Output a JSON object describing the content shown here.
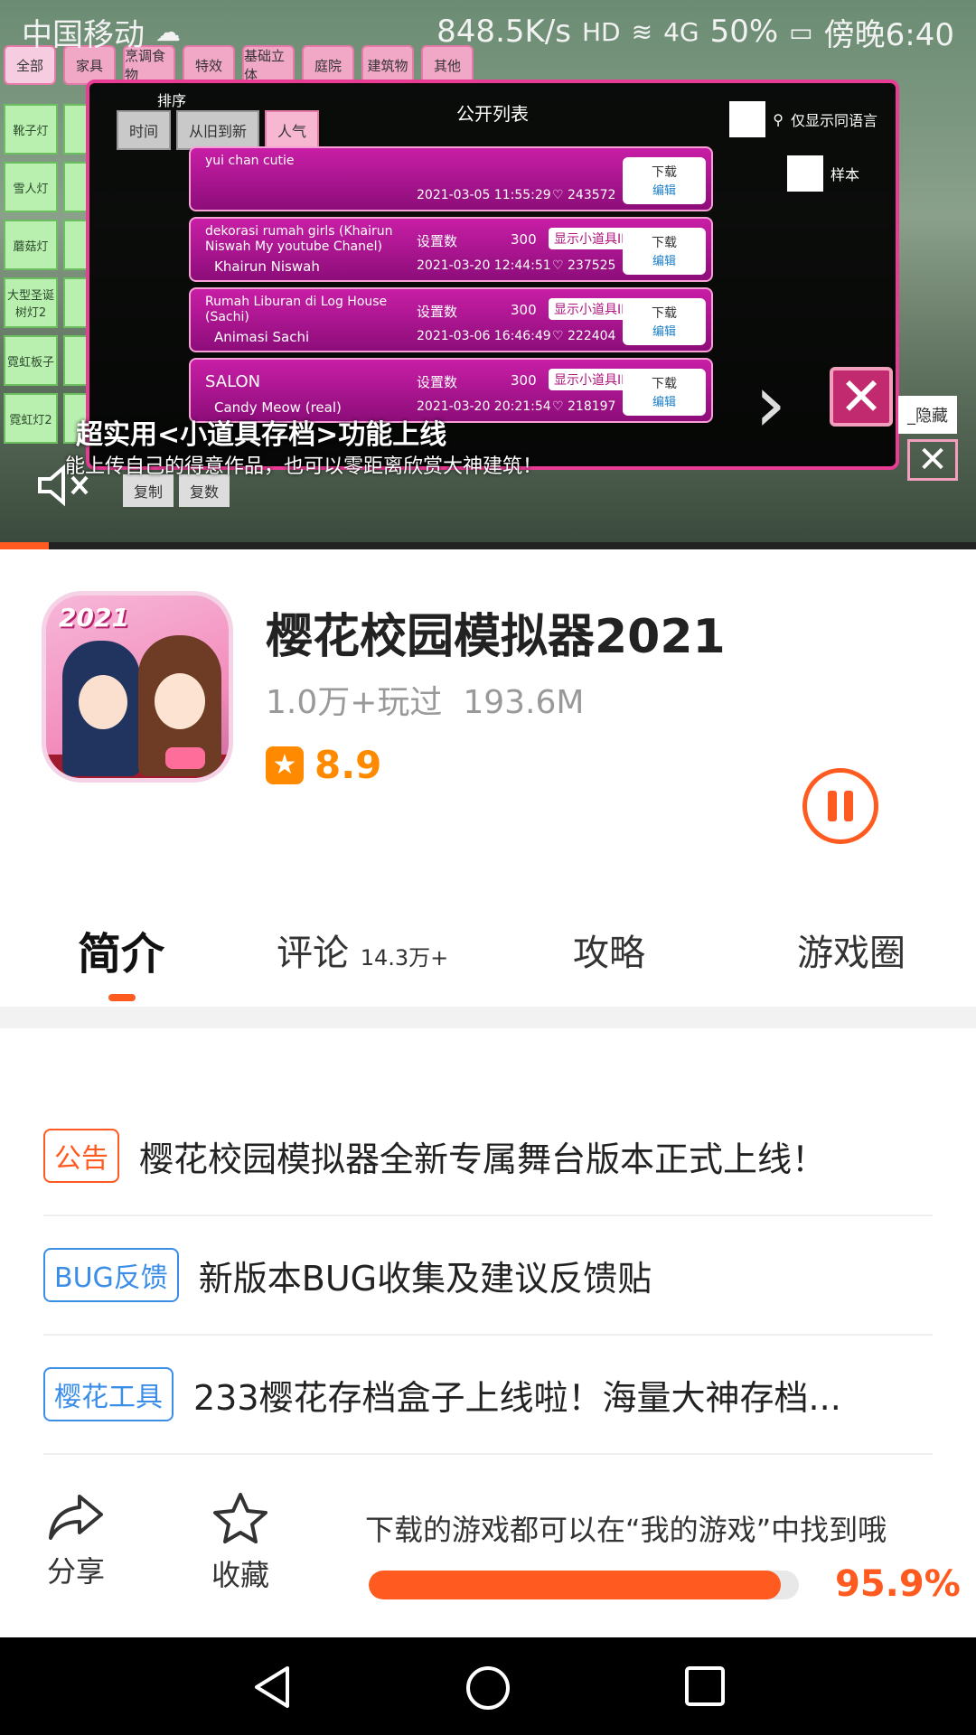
{
  "status_bar": {
    "carrier": "中国移动",
    "speed": "848.5K/s",
    "network": "4G",
    "battery": "50%",
    "time": "傍晚6:40"
  },
  "video": {
    "game_categories": [
      "全部",
      "家具",
      "烹调食物",
      "特效",
      "基础立体",
      "庭院",
      "建筑物",
      "其他"
    ],
    "side_items": [
      "靴子灯",
      "雪人灯",
      "蘑菇灯",
      "大型圣诞树灯2",
      "霓虹板子",
      "霓虹灯2"
    ],
    "dialog_title": "公开列表",
    "sort_label": "排序",
    "sort_options": [
      "时间",
      "从旧到新",
      "人气"
    ],
    "lang_option": "仅显示同语言",
    "sample_option": "样本",
    "rows": [
      {
        "name": "yui chan cutie",
        "author": "",
        "date": "2021-03-05 11:55:29",
        "likes": "243572",
        "set": "",
        "count": "",
        "id_btn": ""
      },
      {
        "name": "dekorasi rumah girls (Khairun Niswah My youtube Chanel)",
        "author": "Khairun Niswah",
        "date": "2021-03-20 12:44:51",
        "likes": "237525",
        "set": "设置数",
        "count": "300",
        "id_btn": "显示小道具ID"
      },
      {
        "name": "Rumah Liburan di Log House (Sachi)",
        "author": "Animasi Sachi",
        "date": "2021-03-06 16:46:49",
        "likes": "222404",
        "set": "设置数",
        "count": "300",
        "id_btn": "显示小道具ID"
      },
      {
        "name": "SALON",
        "author": "Candy Meow (real)",
        "date": "2021-03-20 20:21:54",
        "likes": "218197",
        "set": "设置数",
        "count": "300",
        "id_btn": "显示小道具ID"
      }
    ],
    "download_label": "下载",
    "edit_label": "编辑",
    "hide_label": "_隐藏",
    "copy_buttons": [
      "复制",
      "复数"
    ],
    "banner_title": "超实用<小道具存档>功能上线",
    "banner_sub": "能上传自己的得意作品，也可以零距离欣赏大神建筑！",
    "playback_progress": 0.05
  },
  "app": {
    "icon_year": "2021",
    "name": "樱花校园模拟器2021",
    "plays": "1.0万+玩过",
    "size": "193.6M",
    "rating": "8.9"
  },
  "tabs": [
    {
      "label": "简介",
      "count": ""
    },
    {
      "label": "评论",
      "count": "14.3万+"
    },
    {
      "label": "攻略",
      "count": ""
    },
    {
      "label": "游戏圈",
      "count": ""
    }
  ],
  "announcements": [
    {
      "tag": "公告",
      "text": "樱花校园模拟器全新专属舞台版本正式上线！",
      "color": "#ff5a1f"
    },
    {
      "tag": "BUG反馈",
      "text": "新版本BUG收集及建议反馈贴",
      "color": "#3b8ee8"
    },
    {
      "tag": "樱花工具",
      "text": "233樱花存档盒子上线啦！海量大神存档...",
      "color": "#3b8ee8"
    }
  ],
  "actions": {
    "share": "分享",
    "favorite": "收藏",
    "download_tip": "下载的游戏都可以在“我的游戏”中找到哦",
    "progress": 0.959,
    "progress_label": "95.9%"
  },
  "colors": {
    "accent": "#ff5a1f",
    "rating": "#ff8a00"
  }
}
